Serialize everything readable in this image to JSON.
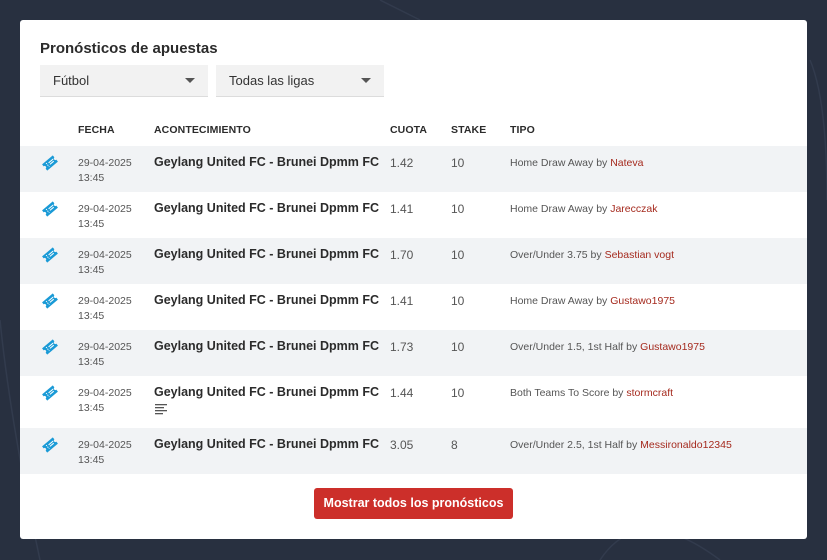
{
  "title": "Pronósticos de apuestas",
  "filters": {
    "sport": "Fútbol",
    "league": "Todas las ligas"
  },
  "table": {
    "headers": {
      "fecha": "FECHA",
      "acontecimiento": "ACONTECIMIENTO",
      "cuota": "CUOTA",
      "stake": "STAKE",
      "tipo": "TIPO"
    },
    "rows": [
      {
        "date": "29-04-2025",
        "time": "13:45",
        "event": "Geylang United FC - Brunei Dpmm FC",
        "odds": "1.42",
        "stake": "10",
        "tip": "Home Draw Away",
        "by": "by",
        "user": "Nateva",
        "has_note": false
      },
      {
        "date": "29-04-2025",
        "time": "13:45",
        "event": "Geylang United FC - Brunei Dpmm FC",
        "odds": "1.41",
        "stake": "10",
        "tip": "Home Draw Away",
        "by": "by",
        "user": "Jarecczak",
        "has_note": false
      },
      {
        "date": "29-04-2025",
        "time": "13:45",
        "event": "Geylang United FC - Brunei Dpmm FC",
        "odds": "1.70",
        "stake": "10",
        "tip": "Over/Under 3.75",
        "by": "by",
        "user": "Sebastian vogt",
        "has_note": false
      },
      {
        "date": "29-04-2025",
        "time": "13:45",
        "event": "Geylang United FC - Brunei Dpmm FC",
        "odds": "1.41",
        "stake": "10",
        "tip": "Home Draw Away",
        "by": "by",
        "user": "Gustawo1975",
        "has_note": false
      },
      {
        "date": "29-04-2025",
        "time": "13:45",
        "event": "Geylang United FC - Brunei Dpmm FC",
        "odds": "1.73",
        "stake": "10",
        "tip": "Over/Under 1.5, 1st Half",
        "by": "by",
        "user": "Gustawo1975",
        "has_note": false
      },
      {
        "date": "29-04-2025",
        "time": "13:45",
        "event": "Geylang United FC - Brunei Dpmm FC",
        "odds": "1.44",
        "stake": "10",
        "tip": "Both Teams To Score",
        "by": "by",
        "user": "stormcraft",
        "has_note": true
      },
      {
        "date": "29-04-2025",
        "time": "13:45",
        "event": "Geylang United FC - Brunei Dpmm FC",
        "odds": "3.05",
        "stake": "8",
        "tip": "Over/Under 2.5, 1st Half",
        "by": "by",
        "user": "Messironaldo12345",
        "has_note": false
      }
    ]
  },
  "button_label": "Mostrar todos los pronósticos",
  "icons": {
    "row_icon": "ticket-icon",
    "note_icon": "text-lines-icon",
    "dropdown_icon": "caret-down-icon"
  },
  "colors": {
    "accent": "#cc2f2a",
    "link": "#a52a1e",
    "ticket": "#1a9ad6",
    "background": "#283040"
  }
}
